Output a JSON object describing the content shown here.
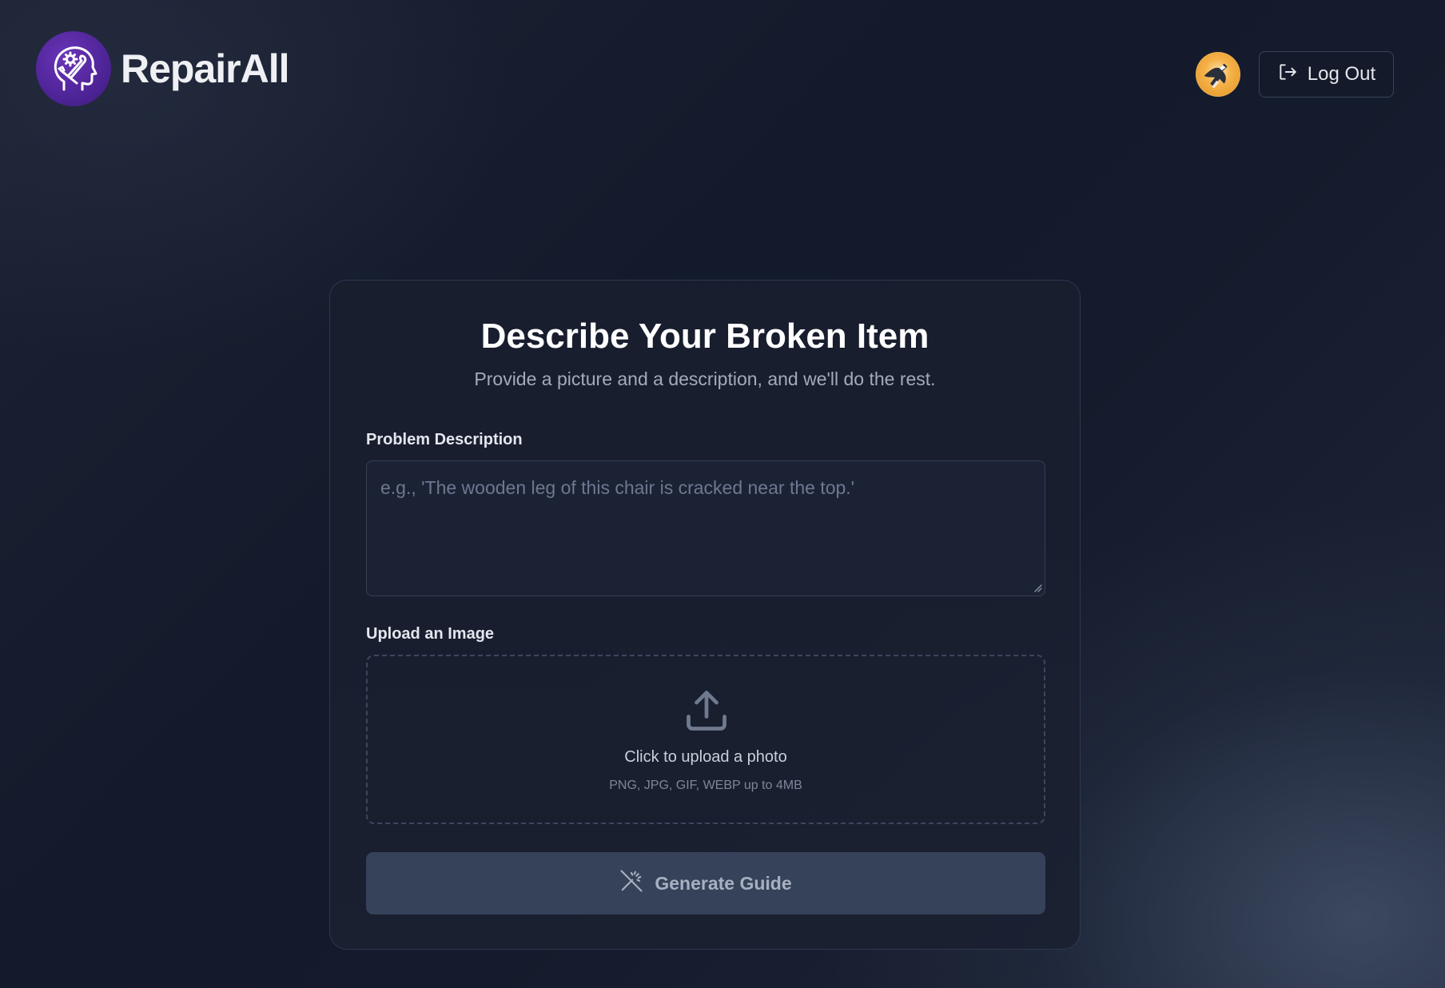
{
  "header": {
    "brand_name": "RepairAll",
    "logout_label": "Log Out"
  },
  "card": {
    "title": "Describe Your Broken Item",
    "subtitle": "Provide a picture and a description, and we'll do the rest.",
    "description": {
      "label": "Problem Description",
      "placeholder": "e.g., 'The wooden leg of this chair is cracked near the top.'",
      "value": ""
    },
    "upload": {
      "label": "Upload an Image",
      "prompt": "Click to upload a photo",
      "hint": "PNG, JPG, GIF, WEBP up to 4MB"
    },
    "generate_label": "Generate Guide"
  },
  "colors": {
    "brand_purple": "#4e2497",
    "button_bg": "#36425a",
    "card_border": "#2f3850"
  },
  "icons": [
    "logo-head-tools-icon",
    "user-avatar",
    "logout-icon",
    "upload-icon",
    "magic-wand-off-icon"
  ]
}
